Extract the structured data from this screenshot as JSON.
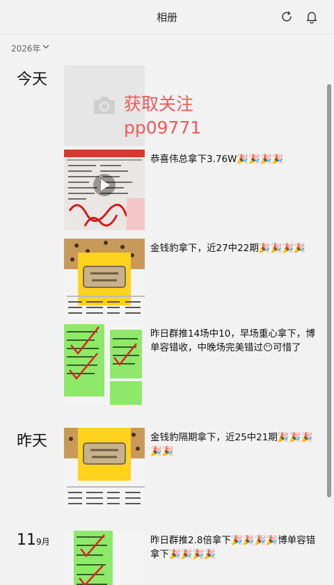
{
  "header": {
    "title": "相册",
    "refresh_icon": "refresh-icon",
    "bell_icon": "bell-icon"
  },
  "filter": {
    "year": "2026年",
    "chevron_icon": "chevron-down-icon"
  },
  "watermark": {
    "line1": "获取关注",
    "line2": "pp09771"
  },
  "groups": [
    {
      "label": "今天"
    },
    {
      "label": "昨天"
    },
    {
      "day": "11",
      "month": "9月"
    }
  ],
  "posts": [
    {
      "text": "恭喜伟总拿下3.76W🎉🎉🎉🎉",
      "thumb": "video"
    },
    {
      "text": "金钱豹拿下，近27中22期🎉🎉🎉🎉",
      "thumb": "leopard"
    },
    {
      "text": "昨日群推14场中10，早场重心拿下，博单容错收，中晚场完美错过😶可惜了",
      "thumb": "green"
    },
    {
      "text": "金钱豹隔期拿下，近25中21期🎉🎉🎉🎉🎉",
      "thumb": "leopard"
    },
    {
      "text": "昨日群推2.8倍拿下🎉🎉🎉🎉博单容错拿下🎉🎉🎉🎉",
      "thumb": "green"
    }
  ],
  "colors": {
    "watermark": "#f05a5a",
    "background": "#f2f2f2",
    "placeholder": "#e6e6e6"
  }
}
